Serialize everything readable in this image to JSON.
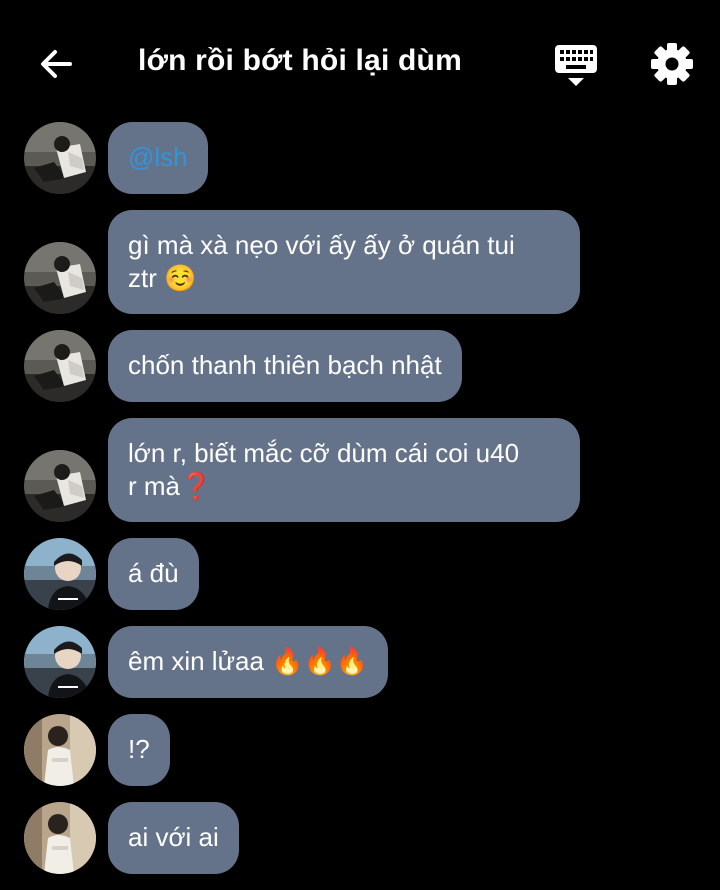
{
  "header": {
    "title": "lớn rồi bớt hỏi lại dùm",
    "back_icon": "arrow-left-icon",
    "keyboard_icon": "keyboard-icon",
    "settings_icon": "gear-icon"
  },
  "colors": {
    "background": "#000000",
    "bubble": "#65738a",
    "mention": "#2f95dc",
    "text": "#ffffff"
  },
  "messages": [
    {
      "sender_avatar": "avatar-a",
      "text": "@lsh"
    },
    {
      "sender_avatar": "avatar-a",
      "text": "gì mà xà nẹo với ấy ấy ở quán tui\nztr ☺️"
    },
    {
      "sender_avatar": "avatar-a",
      "text": "chốn thanh thiên bạch nhật"
    },
    {
      "sender_avatar": "avatar-a",
      "text": "lớn r, biết mắc cỡ dùm cái coi u40\nr mà❓"
    },
    {
      "sender_avatar": "avatar-b",
      "text": "á đù"
    },
    {
      "sender_avatar": "avatar-b",
      "text": "êm xin lửaa 🔥🔥🔥"
    },
    {
      "sender_avatar": "avatar-c",
      "text": "!?"
    },
    {
      "sender_avatar": "avatar-c",
      "text": "ai với ai"
    }
  ]
}
